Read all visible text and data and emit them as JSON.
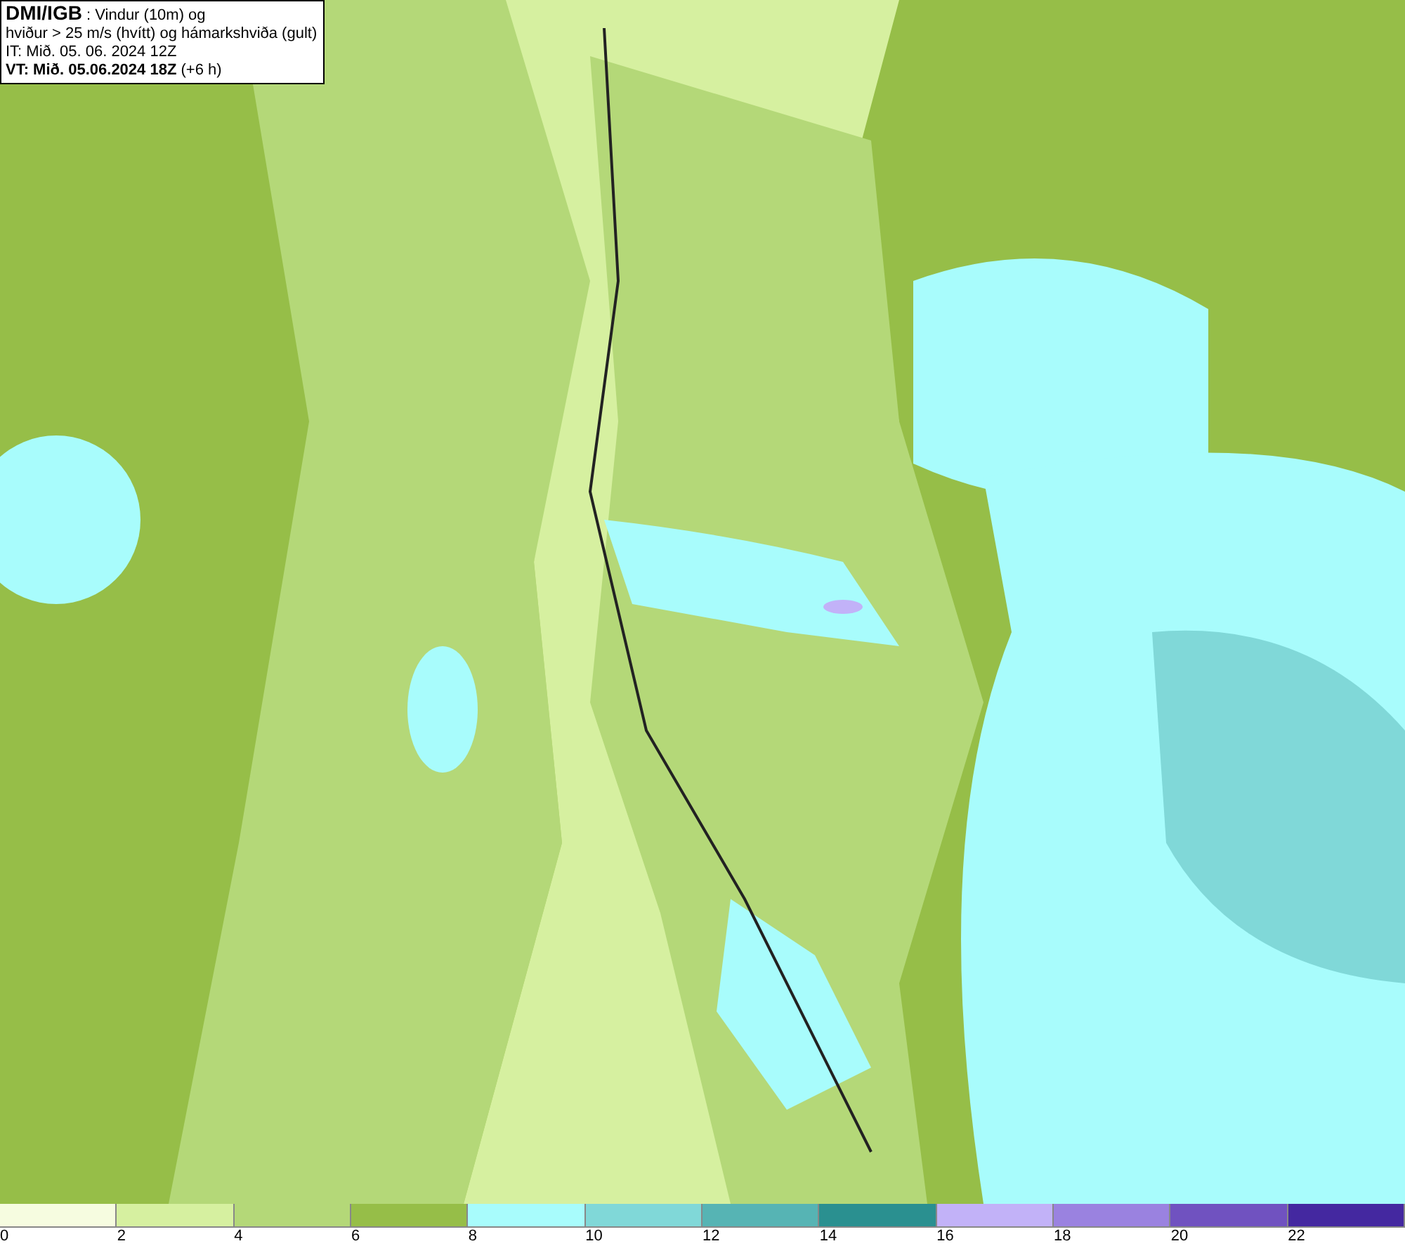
{
  "info_box": {
    "lines": [
      "**DMI/IGB** : Vindur (10m) og",
      "hviður > 25 m/s (hvítt) og hámarkshviða (gult)",
      "IT: Mið. 05. 06. 2024 12Z",
      "**VT: Mið. 05.06.2024 18Z** (+6 h)"
    ]
  },
  "legend": [
    {
      "label": "0",
      "color": "#f6fce0"
    },
    {
      "label": "2",
      "color": "#d6f0a0"
    },
    {
      "label": "4",
      "color": "#b4d878"
    },
    {
      "label": "6",
      "color": "#96be48"
    },
    {
      "label": "8",
      "color": "#a8fcfc"
    },
    {
      "label": "10",
      "color": "#80d8d8"
    },
    {
      "label": "12",
      "color": "#56b4b4"
    },
    {
      "label": "14",
      "color": "#2a9090"
    },
    {
      "label": "16",
      "color": "#c2b2f8"
    },
    {
      "label": "18",
      "color": "#9a82e0"
    },
    {
      "label": "20",
      "color": "#7052c0"
    },
    {
      "label": "22",
      "color": "#4428a0"
    }
  ]
}
